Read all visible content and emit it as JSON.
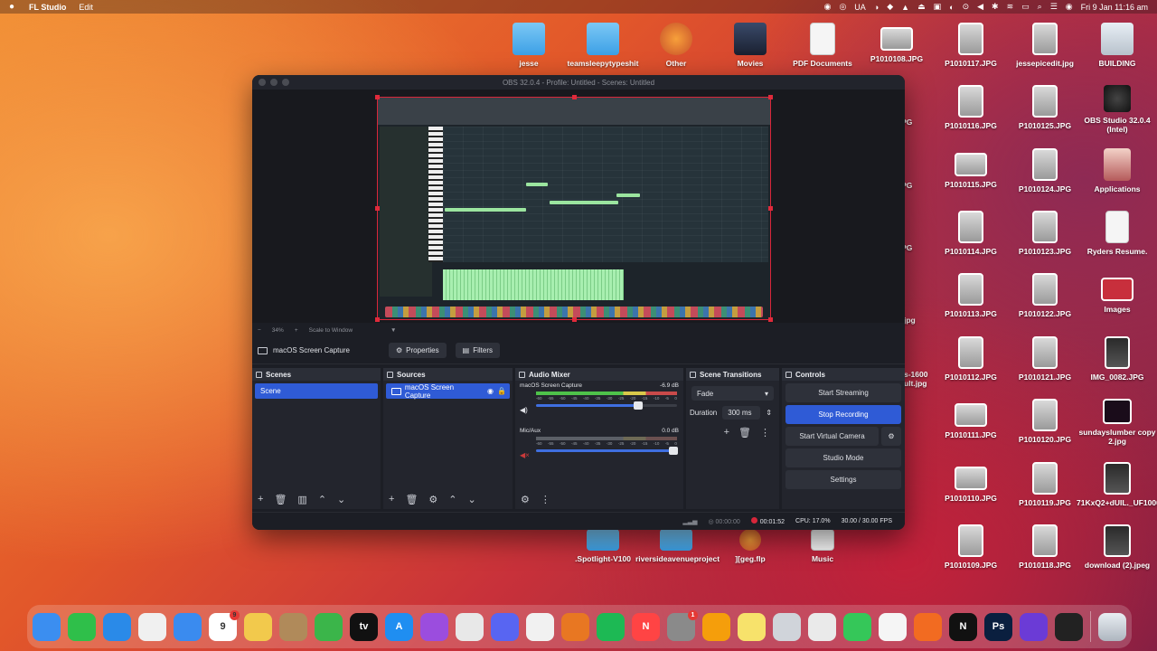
{
  "menubar": {
    "apple_glyph": "",
    "app_name": "FL Studio",
    "menu_items": [
      "Edit"
    ],
    "status_icons": [
      "record",
      "app",
      "UA",
      "app",
      "camera",
      "app",
      "eject",
      "app",
      "app",
      "app",
      "volume",
      "bluetooth",
      "wifi",
      "battery",
      "search",
      "control-center",
      "siri"
    ],
    "clock": "Fri 9 Jan  11:16 am"
  },
  "desktop": {
    "top_row": [
      {
        "name": "jesse",
        "kind": "folder"
      },
      {
        "name": "teamsleepytypeshit",
        "kind": "folder"
      },
      {
        "name": "Other",
        "kind": "app"
      },
      {
        "name": "Movies",
        "kind": "folder-dark"
      },
      {
        "name": "PDF Documents",
        "kind": "doc"
      },
      {
        "name": "P1010108.JPG",
        "kind": "photo"
      },
      {
        "name": "P1010117.JPG",
        "kind": "photo"
      },
      {
        "name": "jessepicedit.jpg",
        "kind": "photo"
      },
      {
        "name": "BUILDING",
        "kind": "folder"
      }
    ],
    "col_a": [
      "P1010116.JPG",
      "P1010115.JPG",
      "P1010114.JPG",
      "P1010113.JPG",
      "P1010112.JPG",
      "P1010111.JPG",
      "P1010110.JPG",
      "P1010109.JPG"
    ],
    "col_b": [
      "P1010125.JPG",
      "P1010124.JPG",
      "P1010123.JPG",
      "P1010122.JPG",
      "P1010121.JPG",
      "P1010120.JPG",
      "P1010119.JPG",
      "P1010118.JPG"
    ],
    "col_c": [
      "OBS Studio 32.0.4 (Intel)",
      "Applications",
      "Ryders Resume.",
      "Images",
      "IMG_0082.JPG",
      "sundayslumber copy 2.jpg",
      "71KxQ2+dUIL._UF1000,10...L80_.jpg",
      "download (2).jpeg"
    ],
    "partial_labels": [
      ".JPG",
      ".JPG",
      ".JPG",
      "jpg",
      "s-1600 ult.jpg"
    ],
    "bottom_row": [
      {
        "name": ".Spotlight-V100",
        "kind": "folder"
      },
      {
        "name": "riversideavenueproject",
        "kind": "folder"
      },
      {
        "name": "][geg.flp",
        "kind": "app"
      },
      {
        "name": "Music",
        "kind": "doc"
      }
    ]
  },
  "obs": {
    "title": "OBS 32.0.4 - Profile: Untitled - Scenes: Untitled",
    "preview_bar": {
      "zoom": "34%",
      "scale_mode": "Scale to Window"
    },
    "source_bar": {
      "source_name": "macOS Screen Capture",
      "properties": "Properties",
      "filters": "Filters"
    },
    "scenes": {
      "header": "Scenes",
      "items": [
        "Scene"
      ]
    },
    "sources": {
      "header": "Sources",
      "items": [
        "macOS Screen Capture"
      ]
    },
    "audio_mixer": {
      "header": "Audio Mixer",
      "channels": [
        {
          "name": "macOS Screen Capture",
          "level": "-6.9 dB",
          "volume": 0.72,
          "muted": false
        },
        {
          "name": "Mic/Aux",
          "level": "0.0 dB",
          "volume": 1.0,
          "muted": true
        }
      ],
      "ticks": [
        "-60",
        "-55",
        "-50",
        "-45",
        "-40",
        "-35",
        "-30",
        "-25",
        "-20",
        "-15",
        "-10",
        "-5",
        "0"
      ]
    },
    "transitions": {
      "header": "Scene Transitions",
      "selected": "Fade",
      "duration_label": "Duration",
      "duration_value": "300 ms"
    },
    "controls": {
      "header": "Controls",
      "start_streaming": "Start Streaming",
      "stop_recording": "Stop Recording",
      "start_virtual_camera": "Start Virtual Camera",
      "studio_mode": "Studio Mode",
      "settings": "Settings"
    },
    "status": {
      "stream_time": "00:00:00",
      "rec_time": "00:01:52",
      "cpu": "CPU: 17.0%",
      "fps": "30.00 / 30.00 FPS"
    }
  },
  "dock": {
    "apps": [
      {
        "name": "finder",
        "color": "#3b8ef0",
        "glyph": ""
      },
      {
        "name": "facetime",
        "color": "#2fbf4a",
        "glyph": ""
      },
      {
        "name": "safari",
        "color": "#2a8ae8",
        "glyph": ""
      },
      {
        "name": "freeform",
        "color": "#f0f0f0",
        "glyph": ""
      },
      {
        "name": "mail",
        "color": "#3a8bef",
        "glyph": ""
      },
      {
        "name": "calendar",
        "color": "#ffffff",
        "glyph": "9",
        "badge": "9"
      },
      {
        "name": "photos",
        "color": "#f2c94c",
        "glyph": ""
      },
      {
        "name": "contacts",
        "color": "#b08a5a",
        "glyph": ""
      },
      {
        "name": "numbers",
        "color": "#3bb54a",
        "glyph": ""
      },
      {
        "name": "tv",
        "color": "#111111",
        "glyph": "tv"
      },
      {
        "name": "app-store",
        "color": "#1f8ef1",
        "glyph": "A"
      },
      {
        "name": "podcasts",
        "color": "#9b4dde",
        "glyph": ""
      },
      {
        "name": "launchpad",
        "color": "#e8e8e8",
        "glyph": ""
      },
      {
        "name": "discord",
        "color": "#5865f2",
        "glyph": ""
      },
      {
        "name": "chrome",
        "color": "#f1f1f1",
        "glyph": ""
      },
      {
        "name": "fl-studio",
        "color": "#e87722",
        "glyph": ""
      },
      {
        "name": "spotify",
        "color": "#1db954",
        "glyph": ""
      },
      {
        "name": "news",
        "color": "#f44",
        "glyph": "N"
      },
      {
        "name": "system-settings",
        "color": "#8a8a8a",
        "glyph": "",
        "badge": "1"
      },
      {
        "name": "pages",
        "color": "#f59e0b",
        "glyph": ""
      },
      {
        "name": "notes",
        "color": "#f7e26b",
        "glyph": ""
      },
      {
        "name": "preview",
        "color": "#d0d4da",
        "glyph": ""
      },
      {
        "name": "airplane",
        "color": "#eaeaea",
        "glyph": ""
      },
      {
        "name": "messages",
        "color": "#35c759",
        "glyph": ""
      },
      {
        "name": "textedit",
        "color": "#f5f5f5",
        "glyph": ""
      },
      {
        "name": "fl-studio-2",
        "color": "#f26b21",
        "glyph": ""
      },
      {
        "name": "native-instruments",
        "color": "#111111",
        "glyph": "N"
      },
      {
        "name": "photoshop",
        "color": "#0a1f3f",
        "glyph": "Ps"
      },
      {
        "name": "ableton",
        "color": "#6b3bd6",
        "glyph": ""
      },
      {
        "name": "obs",
        "color": "#222222",
        "glyph": "",
        "badge": ""
      }
    ],
    "trash": {
      "name": "trash"
    }
  }
}
